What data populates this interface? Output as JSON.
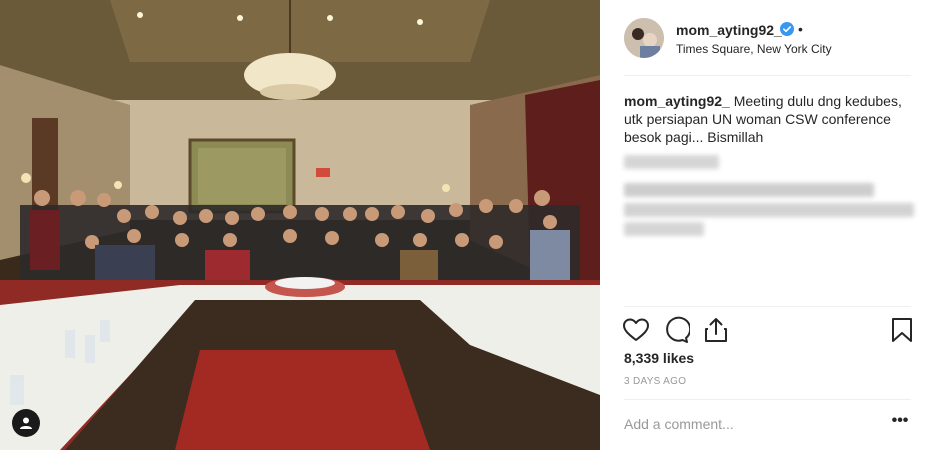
{
  "post": {
    "username": "mom_ayting92_",
    "verified_icon": "verified-badge-icon",
    "dot": "•",
    "location": "Times Square, New York City",
    "caption_user": "mom_ayting92_",
    "caption_text": "Meeting dulu dng kedubes, utk persiapan UN woman CSW conference besok pagi... Bismillah",
    "likes": "8,339 likes",
    "date": "3 DAYS AGO",
    "comment_placeholder": "Add a comment...",
    "more_options": "•••"
  },
  "icons": {
    "like": "heart-icon",
    "comment": "comment-icon",
    "share": "share-icon",
    "save": "bookmark-icon",
    "user_tag": "user-tag-icon"
  },
  "colors": {
    "text": "#262626",
    "muted": "#999999",
    "divider": "#efefef",
    "verified": "#3897f0"
  }
}
